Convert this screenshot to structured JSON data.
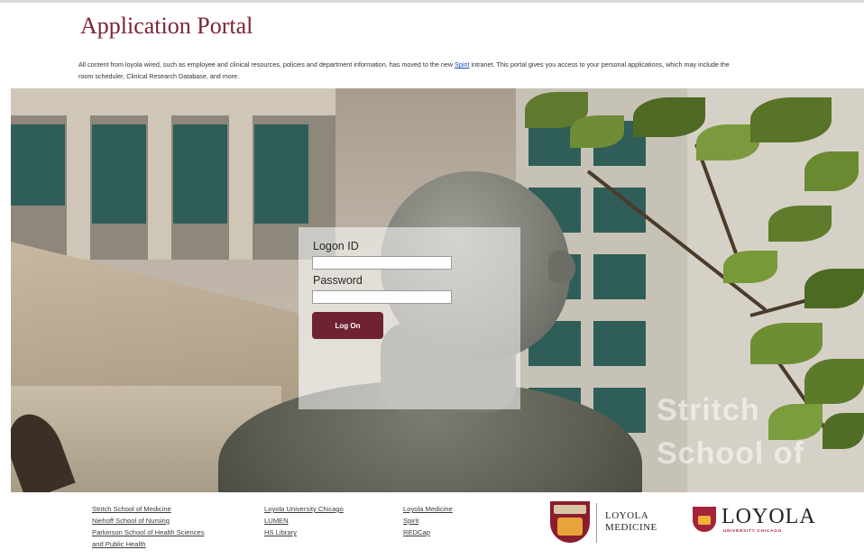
{
  "header": {
    "title": "Application Portal",
    "intro_before_link": "All content from loyola wired, such as employee and clinical resources, policies and department information, has moved to the new ",
    "intro_link": "Spirit",
    "intro_after_link": " intranet. This portal gives you access to your personal applications, which may include the room scheduler, Clinical Research Database, and more."
  },
  "hero": {
    "sign_line1": "Stritch",
    "sign_line2": "School of"
  },
  "login": {
    "logon_id_label": "Logon ID",
    "logon_id_value": "",
    "password_label": "Password",
    "password_value": "",
    "submit_label": "Log On"
  },
  "footer": {
    "col1": [
      "Stritch School of Medicine",
      "Niehoff School of Nursing",
      "Parkinson School of Health Sciences",
      "and Public Health"
    ],
    "col2": [
      "Loyola University Chicago",
      "LUMEN",
      "HS Library"
    ],
    "col3": [
      "Loyola Medicine",
      "Spirit",
      "REDCap"
    ]
  },
  "logos": {
    "loyola_medicine_line1": "LOYOLA",
    "loyola_medicine_line2": "MEDICINE",
    "luc_name": "LOYOLA",
    "luc_sub": "UNIVERSITY CHICAGO"
  },
  "colors": {
    "brand_maroon": "#7b2633",
    "button": "#6f2233",
    "link": "#1a4db3"
  }
}
